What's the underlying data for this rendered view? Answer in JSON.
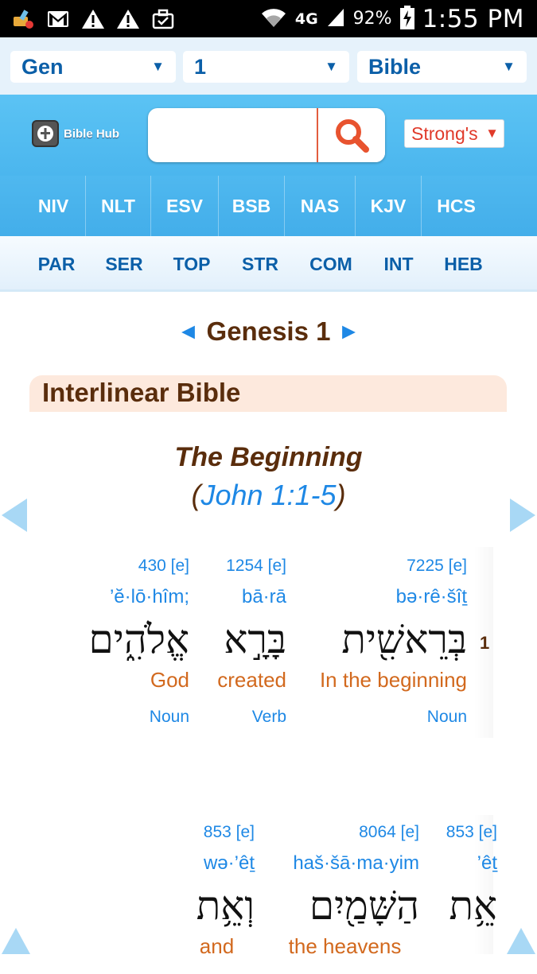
{
  "status": {
    "battery_pct": "92%",
    "time": "1:55 PM",
    "network": "4G"
  },
  "selectors": {
    "book": "Gen",
    "chapter": "1",
    "version": "Bible"
  },
  "header": {
    "logo_text": "Bible Hub",
    "search_placeholder": "",
    "strongs": "Strong's"
  },
  "versions": [
    "NIV",
    "NLT",
    "ESV",
    "BSB",
    "NAS",
    "KJV",
    "HCS"
  ],
  "tools": [
    "PAR",
    "SER",
    "TOP",
    "STR",
    "COM",
    "INT",
    "HEB"
  ],
  "chapter_nav": {
    "prev": "◄",
    "title": "Genesis 1",
    "next": "►"
  },
  "section_title": "Interlinear Bible",
  "heading": {
    "title": "The Beginning",
    "ref_open": "(",
    "ref": "John 1:1-5",
    "ref_close": ")"
  },
  "verse1": {
    "number": "1",
    "words": [
      {
        "strong": "7225 [e]",
        "translit": "bə·rê·šîṯ",
        "hebrew": "בְּרֵאשִׁ֖ית",
        "english": "In the beginning",
        "pos": "Noun"
      },
      {
        "strong": "1254 [e]",
        "translit": "bā·rā",
        "hebrew": "בָּרָ֣א",
        "english": "created",
        "pos": "Verb"
      },
      {
        "strong": "430 [e]",
        "translit": "’ĕ·lō·hîm;",
        "hebrew": "אֱלֹהִ֑ים",
        "english": "God",
        "pos": "Noun"
      }
    ]
  },
  "verse1b": {
    "words": [
      {
        "strong": "853 [e]",
        "translit": "’êṯ",
        "hebrew": "אֵ֥ת",
        "english": ""
      },
      {
        "strong": "8064 [e]",
        "translit": "haš·šā·ma·yim",
        "hebrew": "הַשָּׁמַ֖יִם",
        "english": "the heavens"
      },
      {
        "strong": "853 [e]",
        "translit": "wə·’êṯ",
        "hebrew": "וְאֵ֥ת",
        "english": "and"
      }
    ]
  },
  "colors": {
    "accent": "#1e88e5",
    "brown": "#5a2d0c",
    "orange": "#d2691e",
    "header_blue": "#4bb6ee"
  }
}
